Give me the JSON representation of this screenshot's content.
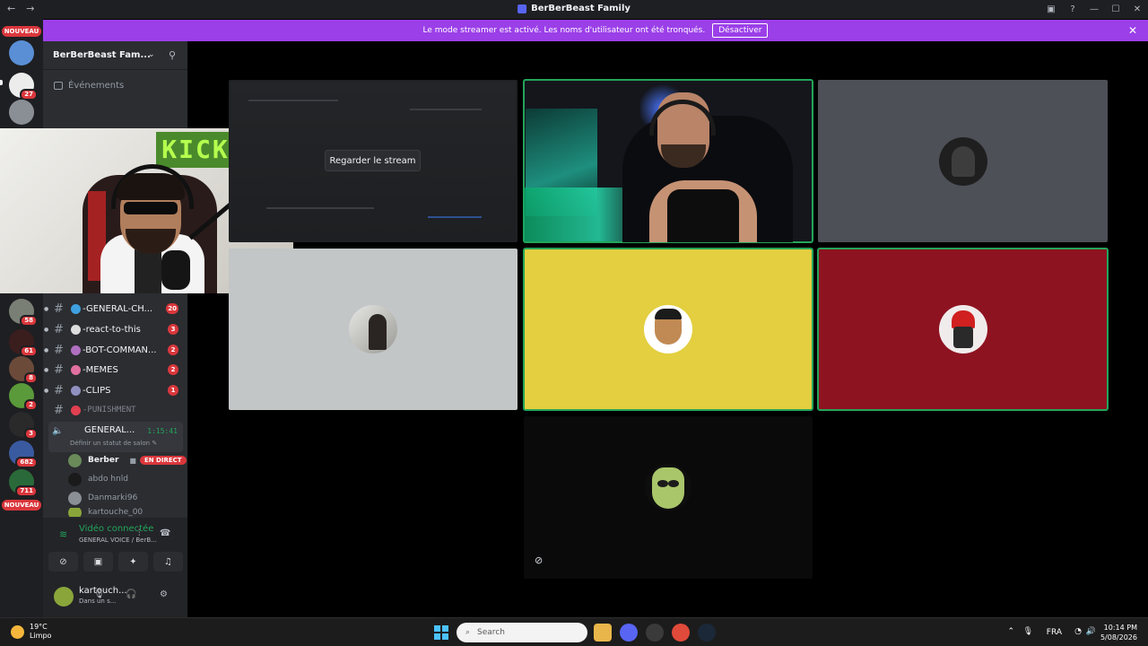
{
  "window": {
    "title": "BerBerBeast Family",
    "back": "←",
    "forward": "→",
    "controls": {
      "minimize": "—",
      "maximize": "☐",
      "close": "✕",
      "inbox": "▣",
      "help": "?"
    }
  },
  "banner": {
    "text": "Le mode streamer est activé. Les noms d'utilisateur ont été tronqués.",
    "button": "Désactiver",
    "close": "✕",
    "color": "#9b3fe8"
  },
  "rail": {
    "new_badge_top": "NOUVEAU",
    "new_badge_bottom": "NOUVEAU",
    "counts": [
      "27",
      "58",
      "61",
      "8",
      "2",
      "3",
      "682",
      "711"
    ]
  },
  "server": {
    "name": "BerBerBeast Fam...",
    "chevron": "⌄",
    "events_label": "Événements"
  },
  "channels": [
    {
      "name": "-GENERAL-CH...",
      "badge": "20",
      "emoji_color": "#3fa0e0"
    },
    {
      "name": "-react-to-this",
      "badge": "3",
      "emoji_color": "#dddddd"
    },
    {
      "name": "-BOT-COMMAN...",
      "badge": "2",
      "emoji_color": "#b070c0"
    },
    {
      "name": "-MEMES",
      "badge": "2",
      "emoji_color": "#e070a0"
    },
    {
      "name": "-CLIPS",
      "badge": "1",
      "emoji_color": "#9090c0"
    },
    {
      "name": "-PUNISHMENT",
      "badge": "",
      "emoji_color": "#e04050"
    }
  ],
  "voice_channel": {
    "name": "GENERAL...",
    "timer": "1:15:41",
    "status": "Définir un statut de salon ✎",
    "users": [
      {
        "name": "Berber",
        "live": true,
        "live_label": "EN DIRECT"
      },
      {
        "name": "abdo hnld",
        "live": false
      },
      {
        "name": "Danmarki96",
        "live": false
      },
      {
        "name": "kartouche_00",
        "live": false
      }
    ]
  },
  "connection": {
    "title": "Vidéo connectée",
    "subtitle": "GENERAL VOICE / BerB..."
  },
  "user": {
    "name": "kartouch...",
    "status": "Dans un s..."
  },
  "webcam": {
    "sign": "KICK"
  },
  "stream": {
    "watch_button": "Regarder le stream"
  },
  "colors": {
    "speaking": "#23a55a",
    "live": "#da373c",
    "tile_yellow": "#e3cf3f",
    "tile_red": "#8e1320",
    "tile_grey": "#4e5058"
  },
  "taskbar": {
    "weather_temp": "19°C",
    "weather_desc": "Limpo",
    "search_placeholder": "Search",
    "lang": "FRA",
    "time": "10:14 PM",
    "date": "5/08/2026"
  }
}
